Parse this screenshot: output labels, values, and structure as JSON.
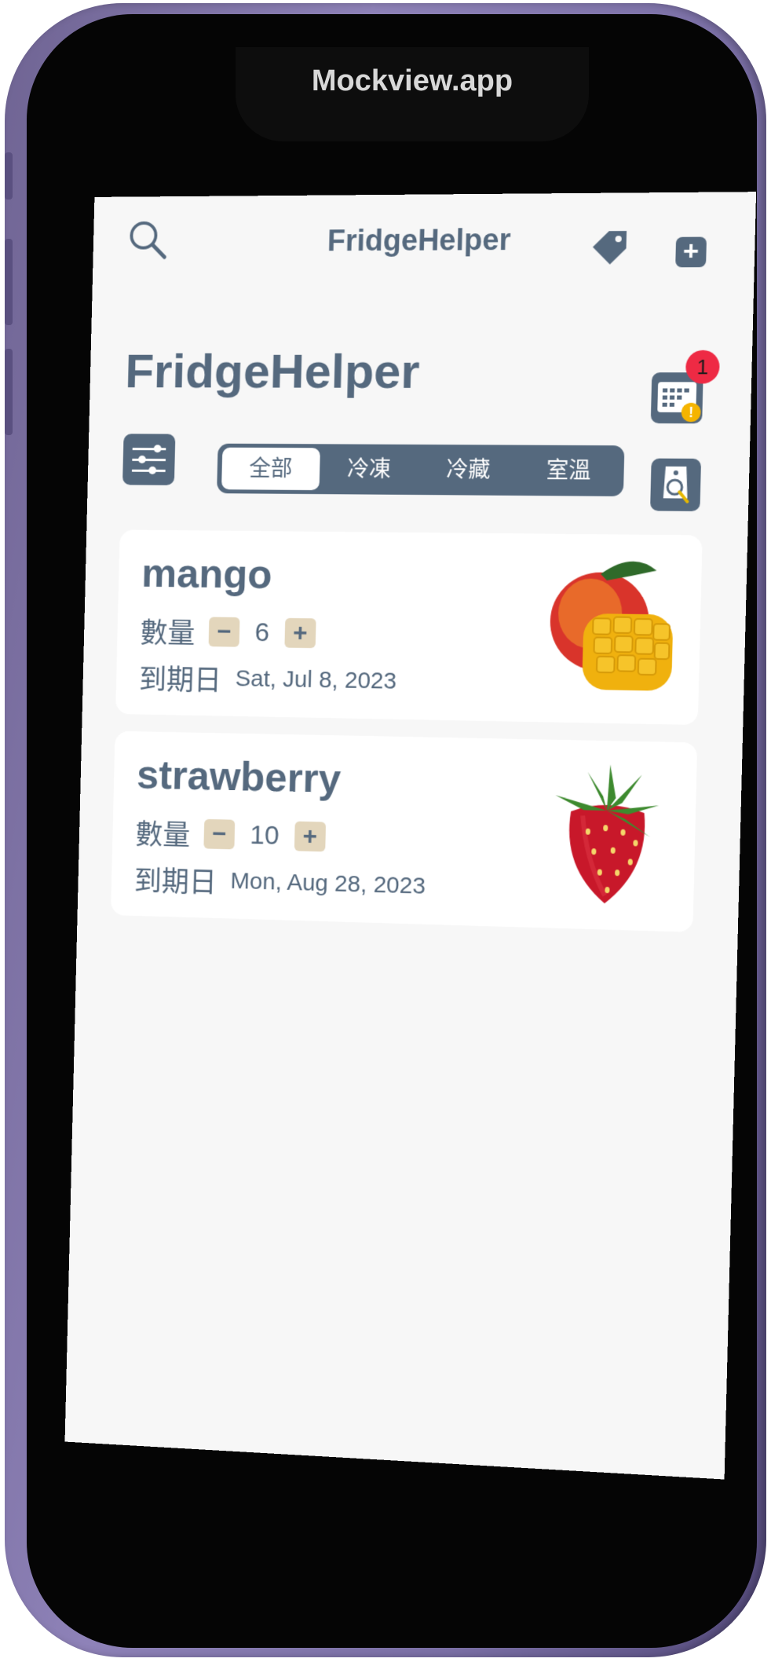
{
  "device": {
    "watermark": "Mockview.app"
  },
  "nav": {
    "title": "FridgeHelper",
    "add_label": "+"
  },
  "header": {
    "large_title": "FridgeHelper",
    "notification_count": "1"
  },
  "segments": [
    "全部",
    "冷凍",
    "冷藏",
    "室溫"
  ],
  "selected_segment": "全部",
  "items": [
    {
      "name": "mango",
      "quantity_label": "數量",
      "quantity": "6",
      "expiry_label": "到期日",
      "expiry_date": "Sat, Jul 8, 2023",
      "decrement_label": "−",
      "increment_label": "+"
    },
    {
      "name": "strawberry",
      "quantity_label": "數量",
      "quantity": "10",
      "expiry_label": "到期日",
      "expiry_date": "Mon, Aug 28, 2023",
      "decrement_label": "−",
      "increment_label": "+"
    }
  ],
  "colors": {
    "primary": "#55697e",
    "badge": "#ee2a44",
    "stepper": "#e3d6bc",
    "frame": "#7b70a6",
    "warning": "#f5b400"
  }
}
